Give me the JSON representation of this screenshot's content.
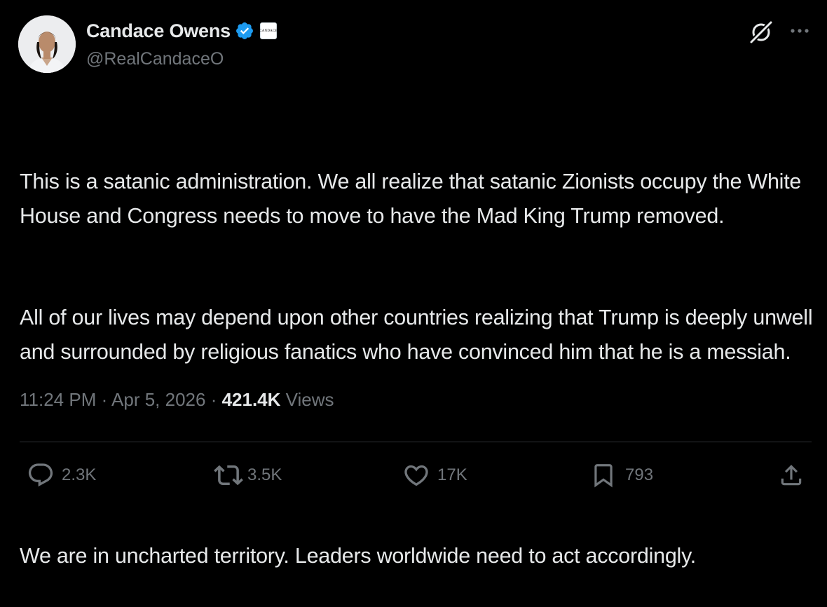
{
  "author": {
    "display_name": "Candace Owens",
    "handle": "@RealCandaceO",
    "verified_icon": "verified-badge-icon",
    "affiliate_badge_text": "CANDACE"
  },
  "header_actions": {
    "grok_icon": "grok-icon",
    "more_icon": "more-icon"
  },
  "tweet": {
    "paragraphs": [
      "This is a satanic administration. We all realize that satanic Zionists occupy the White House and Congress needs to move to have the Mad King Trump removed.",
      "All of our lives may depend upon other countries realizing that Trump is deeply unwell and surrounded by religious fanatics who have convinced him that he is a messiah.",
      "",
      "We are in uncharted territory. Leaders worldwide need to act accordingly."
    ]
  },
  "meta": {
    "time": "11:24 PM",
    "separator": " · ",
    "date": "Apr 5, 2026",
    "views_count": "421.4K",
    "views_label": " Views"
  },
  "actions": {
    "replies": {
      "icon": "reply-icon",
      "count": "2.3K"
    },
    "reposts": {
      "icon": "repost-icon",
      "count": "3.5K"
    },
    "likes": {
      "icon": "heart-icon",
      "count": "17K"
    },
    "bookmarks": {
      "icon": "bookmark-icon",
      "count": "793"
    },
    "share": {
      "icon": "share-icon"
    }
  },
  "colors": {
    "background": "#000000",
    "primary_text": "#e7e9ea",
    "secondary_text": "#71767b",
    "verified_blue": "#1d9bf0",
    "divider": "#2f3336"
  }
}
